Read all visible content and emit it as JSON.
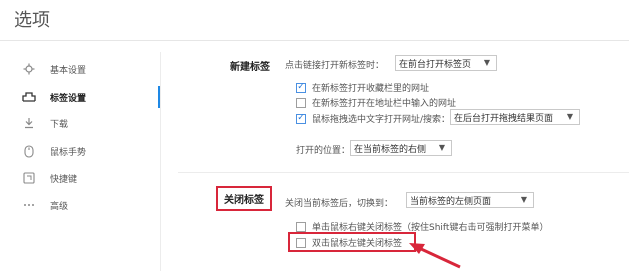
{
  "window": {
    "title": "选项"
  },
  "sidebar": {
    "items": [
      {
        "label": "基本设置",
        "icon": "gear-icon",
        "active": false
      },
      {
        "label": "标签设置",
        "icon": "tab-icon",
        "active": true
      },
      {
        "label": "下载",
        "icon": "download-icon",
        "active": false
      },
      {
        "label": "鼠标手势",
        "icon": "mouse-icon",
        "active": false
      },
      {
        "label": "快捷键",
        "icon": "keyboard-icon",
        "active": false
      },
      {
        "label": "高级",
        "icon": "more-icon",
        "active": false
      }
    ]
  },
  "new_tab": {
    "label": "新建标签",
    "click_link_text": "点击链接打开新标签时：",
    "click_link_select": "在前台打开标签页",
    "options": [
      {
        "label": "在新标签打开收藏栏里的网址",
        "checked": true
      },
      {
        "label": "在新标签打开在地址栏中输入的网址",
        "checked": false
      },
      {
        "label": "鼠标拖拽选中文字打开网址/搜索：",
        "checked": true
      }
    ],
    "drag_select": "在后台打开拖拽结果页面",
    "position_text": "打开的位置：",
    "position_select": "在当前标签的右侧"
  },
  "close_tab": {
    "label": "关闭标签",
    "after_close_text": "关闭当前标签后，切换到：",
    "after_close_select": "当前标签的左侧页面",
    "options": [
      {
        "label": "单击鼠标右键关闭标签（按住Shift键右击可强制打开菜单）",
        "checked": false
      },
      {
        "label": "双击鼠标左键关闭标签",
        "checked": false
      }
    ]
  },
  "colors": {
    "accent": "#1e88e5",
    "highlight": "#d8263a",
    "check": "#2979d8"
  }
}
